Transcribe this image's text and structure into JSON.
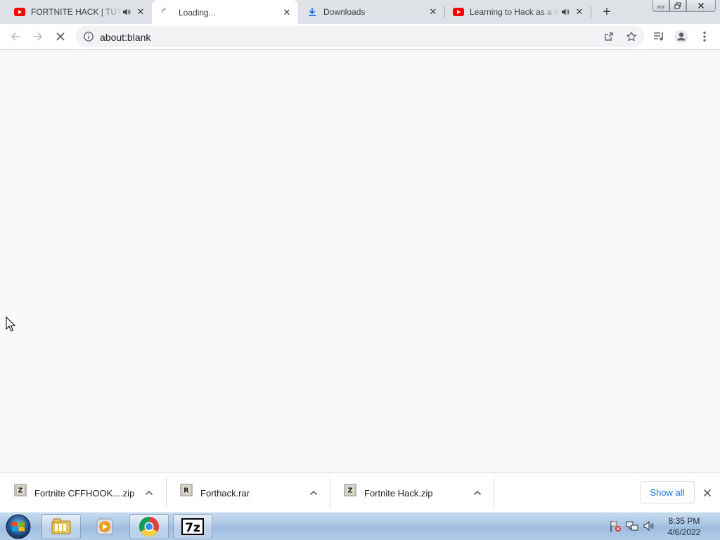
{
  "tabs": [
    {
      "title": "FORTNITE HACK | TUTORIAL",
      "favicon": "youtube-icon",
      "audio": true
    },
    {
      "title": "Loading...",
      "favicon": "loading-spinner-icon",
      "audio": false,
      "active": true
    },
    {
      "title": "Downloads",
      "favicon": "download-icon",
      "audio": false
    },
    {
      "title": "Learning to Hack as a Kid",
      "favicon": "youtube-icon",
      "audio": true
    }
  ],
  "toolbar": {
    "url": "about:blank"
  },
  "downloads": [
    {
      "filename": "Fortnite CFFHOOK....zip",
      "icon": "zip-archive-icon"
    },
    {
      "filename": "Forthack.rar",
      "icon": "rar-archive-icon"
    },
    {
      "filename": "Fortnite Hack.zip",
      "icon": "zip-archive-icon"
    }
  ],
  "downloads_bar": {
    "show_all_label": "Show all"
  },
  "taskbar": {
    "apps": [
      "file-explorer-icon",
      "media-player-icon",
      "chrome-icon",
      "7zip-icon"
    ],
    "time": "8:35 PM",
    "date": "4/6/2022"
  },
  "colors": {
    "accent": "#1a73e8",
    "youtube": "#ff0000",
    "tabstrip": "#dee1e6"
  }
}
